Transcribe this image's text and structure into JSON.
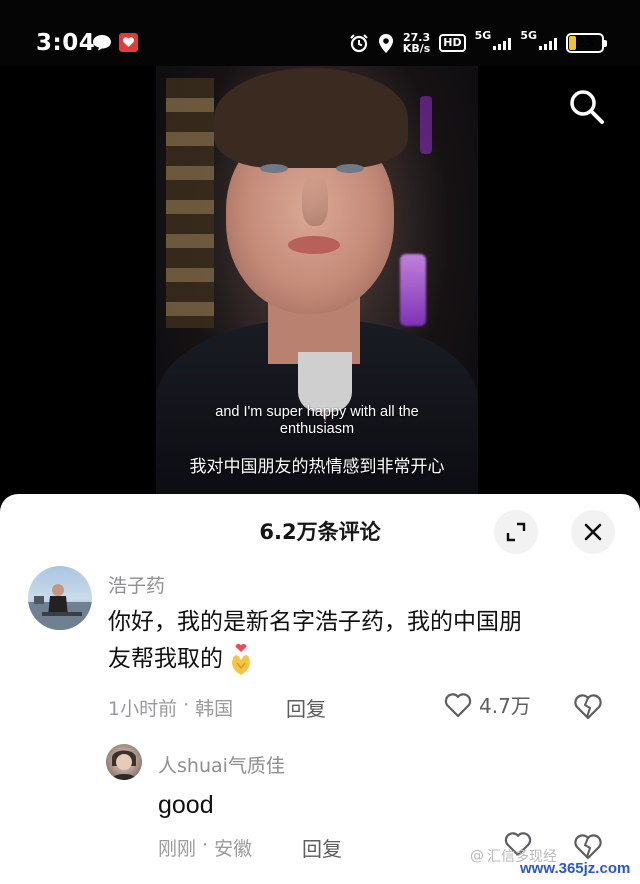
{
  "status_bar": {
    "time": "3:04",
    "speed_value": "27.3",
    "speed_unit": "KB/s",
    "hd_label": "HD",
    "sim1_label": "5G",
    "sim2_label": "5G",
    "battery_level": "23",
    "battery_color": "#f2c230",
    "icons": [
      "message-bubble-icon",
      "red-app-icon",
      "alarm-clock-icon",
      "location-pin-icon",
      "signal-bars-icon",
      "battery-icon"
    ]
  },
  "video": {
    "subtitle_en_line1": "and I'm super happy with all the",
    "subtitle_en_line2": "enthusiasm",
    "subtitle_zh": "我对中国朋友的热情感到非常开心",
    "search_icon": "search-icon"
  },
  "comments_panel": {
    "title": "6.2万条评论",
    "expand_icon": "expand-icon",
    "close_icon": "close-icon",
    "comments": [
      {
        "username": "浩子药",
        "text_line1": "你好，我的是新名字浩子药，我的中国朋",
        "text_line2": "友帮我取的",
        "emoji": "heart-hands-emoji",
        "time": "1小时前",
        "separator": "·",
        "location": "韩国",
        "reply_label": "回复",
        "like_count": "4.7万"
      },
      {
        "username": "人shuai气质佳",
        "text": "good",
        "time": "刚刚",
        "separator": "·",
        "location": "安徽",
        "reply_label": "回复",
        "like_count": ""
      }
    ]
  },
  "watermark": {
    "prefix": "@",
    "text": "汇信多现经",
    "url": "www.365jz.com"
  }
}
